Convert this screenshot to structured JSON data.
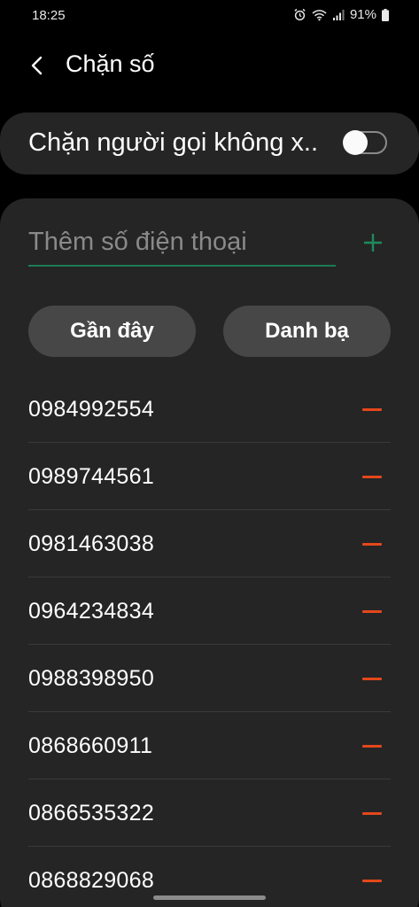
{
  "status_bar": {
    "time": "18:25",
    "battery": "91%"
  },
  "header": {
    "title": "Chặn số"
  },
  "block_unknown": {
    "label": "Chặn người gọi không x..",
    "enabled": false
  },
  "add_number": {
    "placeholder": "Thêm số điện thoại",
    "value": ""
  },
  "chips": {
    "recent": "Gần đây",
    "contacts": "Danh bạ"
  },
  "blocked_numbers": [
    "0984992554",
    "0989744561",
    "0981463038",
    "0964234834",
    "0988398950",
    "0868660911",
    "0866535322",
    "0868829068"
  ],
  "colors": {
    "background": "#000000",
    "card": "#252525",
    "chip": "#474747",
    "accent_green": "#1e7a55",
    "remove_red": "#e4471b"
  }
}
